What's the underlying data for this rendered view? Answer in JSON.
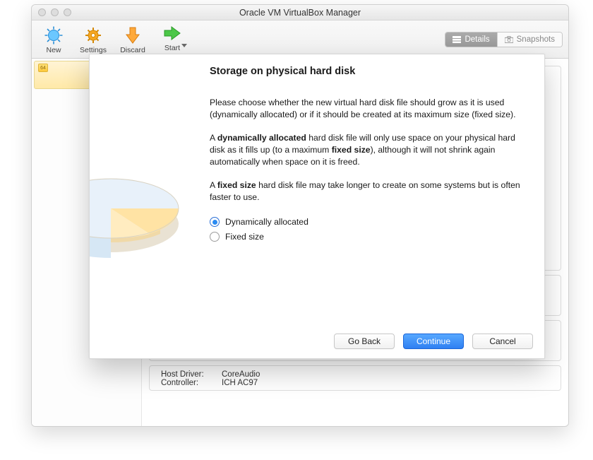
{
  "window": {
    "title": "Oracle VM VirtualBox Manager"
  },
  "toolbar": {
    "items": [
      {
        "label": "New"
      },
      {
        "label": "Settings"
      },
      {
        "label": "Discard"
      },
      {
        "label": "Start"
      }
    ],
    "segmented": {
      "details": "Details",
      "snapshots": "Snapshots"
    }
  },
  "sidebar": {
    "vm_badge": "64"
  },
  "background_details": {
    "host_driver_label": "Host Driver:",
    "host_driver_value": "CoreAudio",
    "controller_label": "Controller:",
    "controller_value": "ICH AC97"
  },
  "dialog": {
    "title": "Storage on physical hard disk",
    "p1": "Please choose whether the new virtual hard disk file should grow as it is used (dynamically allocated) or if it should be created at its maximum size (fixed size).",
    "p2_a": "A ",
    "p2_b": "dynamically allocated",
    "p2_c": " hard disk file will only use space on your physical hard disk as it fills up (to a maximum ",
    "p2_d": "fixed size",
    "p2_e": "), although it will not shrink again automatically when space on it is freed.",
    "p3_a": "A ",
    "p3_b": "fixed size",
    "p3_c": " hard disk file may take longer to create on some systems but is often faster to use.",
    "options": {
      "dynamic": "Dynamically allocated",
      "fixed": "Fixed size"
    },
    "buttons": {
      "back": "Go Back",
      "continue": "Continue",
      "cancel": "Cancel"
    }
  }
}
